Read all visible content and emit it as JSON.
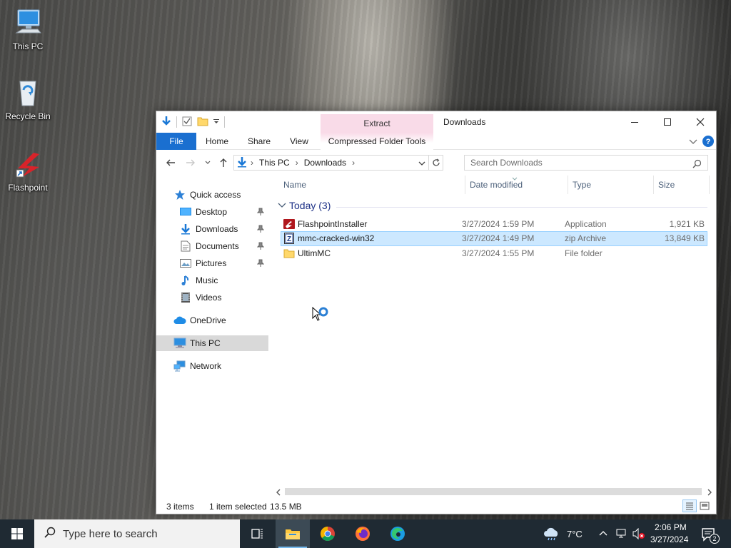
{
  "desktop": {
    "icons": [
      {
        "label": "This PC",
        "icon": "this-pc-icon"
      },
      {
        "label": "Recycle Bin",
        "icon": "recycle-bin-icon"
      },
      {
        "label": "Flashpoint",
        "icon": "flashpoint-icon"
      }
    ]
  },
  "window": {
    "title": "Downloads",
    "contextual_tab_group": "Extract",
    "ribbon_tabs": [
      "File",
      "Home",
      "Share",
      "View",
      "Compressed Folder Tools"
    ],
    "address": {
      "segments": [
        "This PC",
        "Downloads"
      ]
    },
    "search_placeholder": "Search Downloads",
    "nav": {
      "quick_access": "Quick access",
      "items": [
        {
          "label": "Desktop",
          "pinned": true,
          "icon": "desktop-folder-icon"
        },
        {
          "label": "Downloads",
          "pinned": true,
          "icon": "downloads-folder-icon"
        },
        {
          "label": "Documents",
          "pinned": true,
          "icon": "documents-folder-icon"
        },
        {
          "label": "Pictures",
          "pinned": true,
          "icon": "pictures-folder-icon"
        },
        {
          "label": "Music",
          "pinned": false,
          "icon": "music-folder-icon"
        },
        {
          "label": "Videos",
          "pinned": false,
          "icon": "videos-folder-icon"
        }
      ],
      "onedrive": "OneDrive",
      "this_pc": "This PC",
      "network": "Network"
    },
    "columns": [
      "Name",
      "Date modified",
      "Type",
      "Size"
    ],
    "group": {
      "label": "Today (3)"
    },
    "files": [
      {
        "name": "FlashpointInstaller",
        "date": "3/27/2024 1:59 PM",
        "type": "Application",
        "size": "1,921 KB",
        "icon": "flashpoint-app-icon",
        "selected": false
      },
      {
        "name": "mmc-cracked-win32",
        "date": "3/27/2024 1:49 PM",
        "type": "zip Archive",
        "size": "13,849 KB",
        "icon": "zip-archive-icon",
        "selected": true
      },
      {
        "name": "UltimMC",
        "date": "3/27/2024 1:55 PM",
        "type": "File folder",
        "size": "",
        "icon": "folder-icon",
        "selected": false
      }
    ],
    "status": {
      "items": "3 items",
      "selected": "1 item selected",
      "size": "13.5 MB"
    }
  },
  "taskbar": {
    "search_placeholder": "Type here to search",
    "weather": "7°C",
    "time": "2:06 PM",
    "date": "3/27/2024",
    "notification_count": "2"
  },
  "colors": {
    "file_tab": "#1a6fd0",
    "context_tab": "#f9dbe8",
    "selection": "#cce8ff",
    "taskbar": "#1f2a33"
  }
}
